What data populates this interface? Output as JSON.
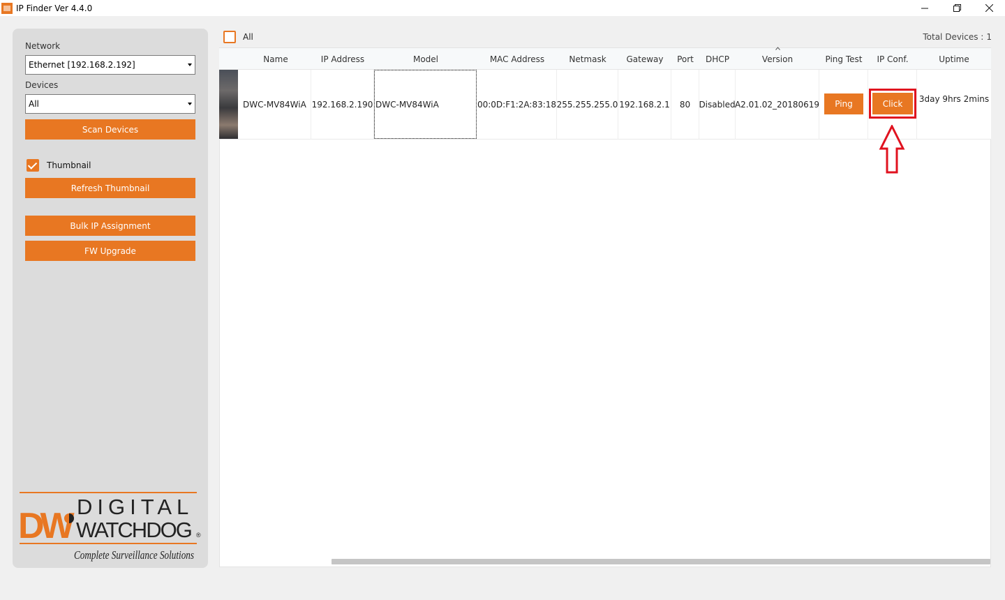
{
  "window": {
    "title": "IP Finder  Ver 4.4.0",
    "minimize_icon": "minimize-icon",
    "restore_icon": "restore-icon",
    "close_icon": "close-icon"
  },
  "sidebar": {
    "network_label": "Network",
    "network_value": "Ethernet [192.168.2.192]",
    "devices_label": "Devices",
    "devices_value": "All",
    "scan_button": "Scan Devices",
    "thumbnail_label": "Thumbnail",
    "thumbnail_checked": true,
    "refresh_button": "Refresh Thumbnail",
    "bulk_button": "Bulk IP Assignment",
    "fw_button": "FW Upgrade",
    "logo": {
      "mark": "DW",
      "line1": "DIGITAL",
      "line2": "WATCHDOG",
      "registered": "®",
      "tagline": "Complete Surveillance Solutions"
    }
  },
  "toolbar": {
    "all_label": "All",
    "all_checked": false,
    "total_label": "Total Devices :",
    "total_value": "1"
  },
  "table": {
    "columns": [
      "Name",
      "IP Address",
      "Model",
      "MAC Address",
      "Netmask",
      "Gateway",
      "Port",
      "DHCP",
      "Version",
      "Ping Test",
      "IP Conf.",
      "Uptime"
    ],
    "rows": [
      {
        "name": "DWC-MV84WiA",
        "ip": "192.168.2.190",
        "model": "DWC-MV84WiA",
        "mac": "00:0D:F1:2A:83:18",
        "netmask": "255.255.255.0",
        "gateway": "192.168.2.1",
        "port": "80",
        "dhcp": "Disabled",
        "version": "A2.01.02_20180619",
        "ping_button": "Ping",
        "ipconf_button": "Click",
        "uptime": "3day 9hrs 2mins"
      }
    ]
  },
  "colors": {
    "accent": "#e87722",
    "highlight": "#e0121f"
  }
}
